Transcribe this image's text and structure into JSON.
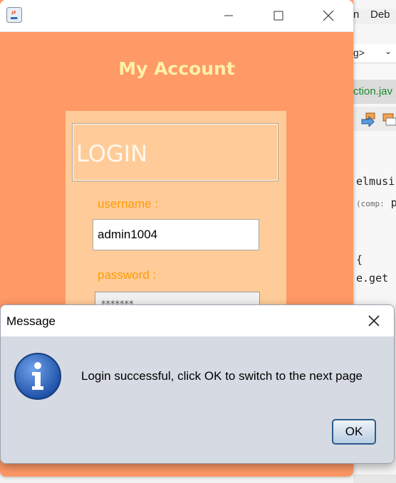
{
  "window": {
    "content_title": "My Account",
    "login_heading": "LOGIN",
    "username_label": "username :",
    "username_value": "admin1004",
    "password_label": "password :",
    "password_mask": "*******"
  },
  "dialog": {
    "title": "Message",
    "message": "Login successful, click OK to switch to the next page",
    "ok_label": "OK"
  },
  "ide": {
    "menu_items": [
      "n",
      "Deb"
    ],
    "combo_text": "g>",
    "tab_label": "ction.jav",
    "code_lines": [
      "elmusi",
      "(comp: p",
      "{",
      "e.get"
    ]
  },
  "colors": {
    "window_bg": "#ff9966",
    "panel_bg": "#ffcc99",
    "title_text": "#fff0a8",
    "label_text": "#ff9900"
  },
  "icons": [
    "java-app-icon",
    "minimize-icon",
    "maximize-icon",
    "close-icon",
    "information-icon"
  ]
}
